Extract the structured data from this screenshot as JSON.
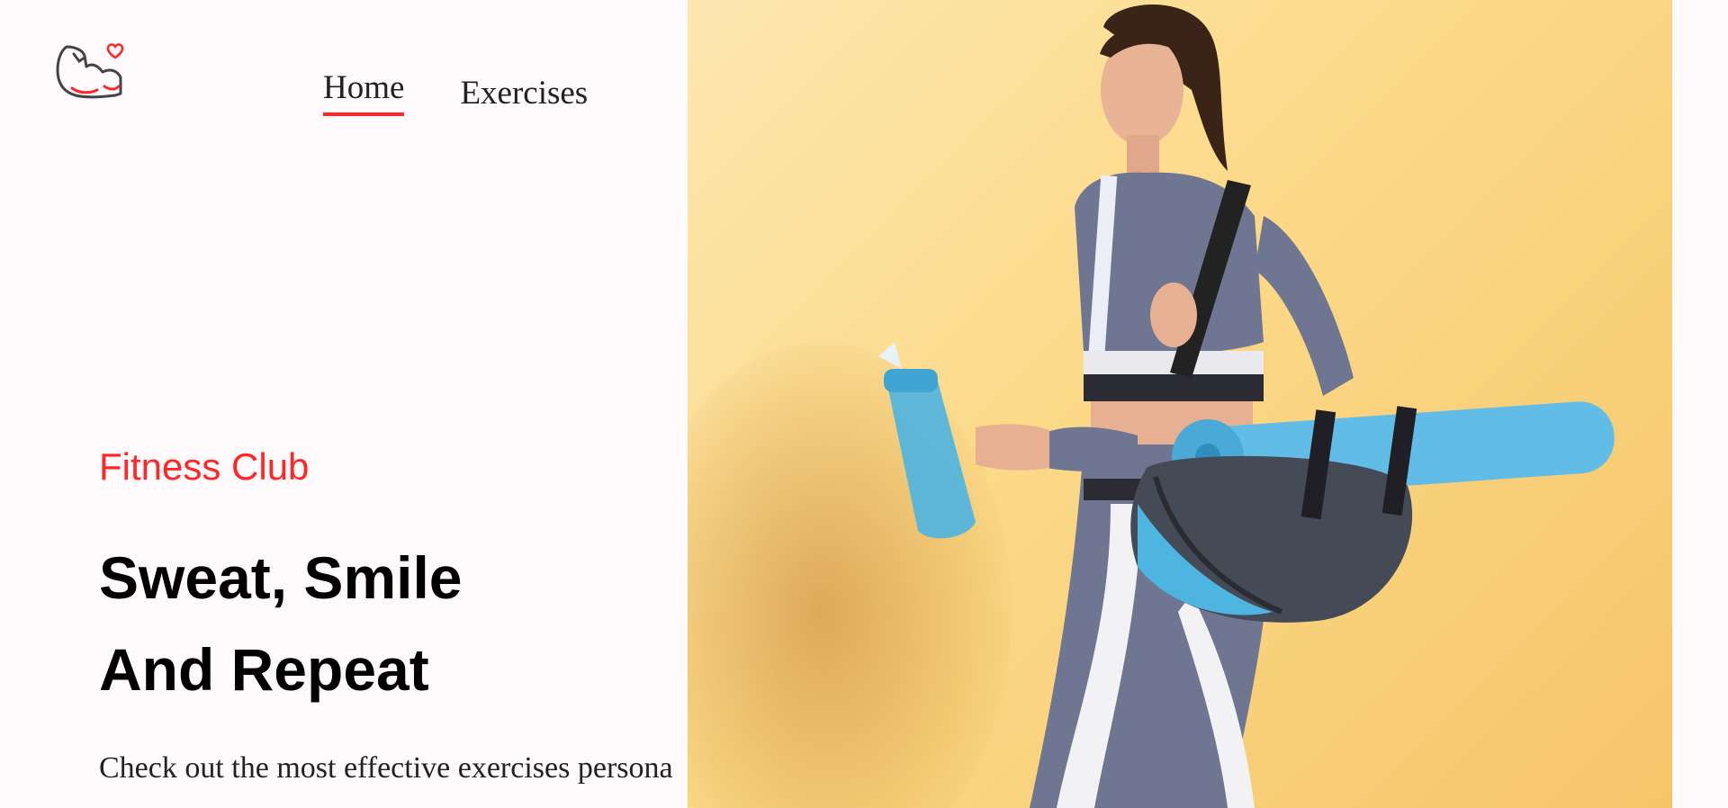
{
  "nav": {
    "items": [
      {
        "label": "Home",
        "active": true
      },
      {
        "label": "Exercises",
        "active": false
      }
    ]
  },
  "hero": {
    "tagline": "Fitness Club",
    "headline_line1": "Sweat, Smile",
    "headline_line2": "And Repeat",
    "subtext": "Check out the most effective exercises persona"
  },
  "colors": {
    "accent": "#ff2625",
    "page_background": "#fffafb",
    "banner_background": "#fbd987"
  },
  "icons": {
    "logo": "flexed-arm-heart-icon"
  }
}
